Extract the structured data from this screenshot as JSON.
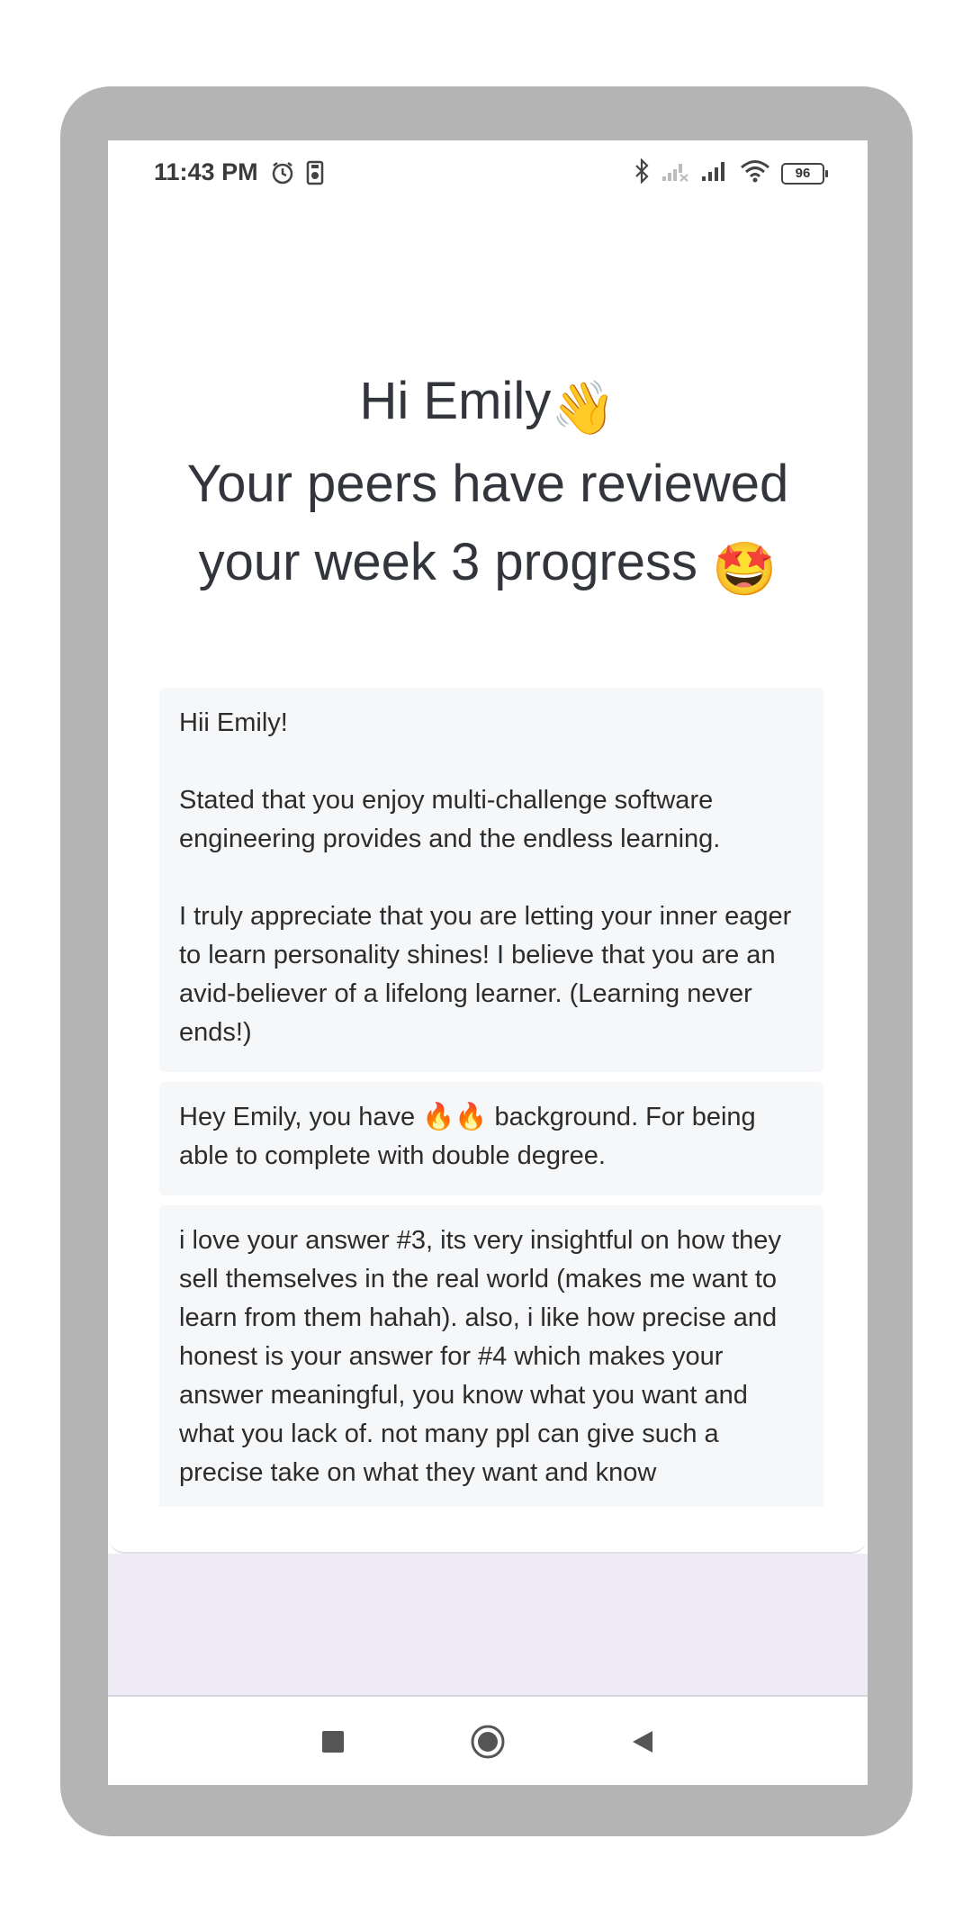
{
  "status_bar": {
    "time": "11:43 PM",
    "left_icons": [
      "alarm-icon",
      "storage-icon"
    ],
    "right_icons": [
      "bluetooth-icon",
      "signal-nosim-icon",
      "signal-icon",
      "wifi-icon"
    ],
    "battery": "96"
  },
  "greeting": {
    "line1": "Hi Emily",
    "line1_emoji": "👋",
    "line2": "Your peers have reviewed",
    "line3": "your week 3 progress",
    "line3_emoji": "🤩"
  },
  "reviews": [
    {
      "text": "Hii Emily!\n\nStated that you enjoy multi-challenge software engineering provides and the endless learning.\n\nI truly appreciate that you are letting your inner eager to learn personality shines! I believe that you are an avid-believer of a lifelong learner. (Learning never ends!)"
    },
    {
      "text": "Hey Emily, you have 🔥🔥 background. For being able to complete with double degree."
    },
    {
      "text": "i love your answer #3, its very insightful on how they sell themselves in the real world (makes me want to learn from them hahah). also, i like how precise and honest is your answer for #4 which makes your answer meaningful, you know what you want and what you lack of. not many ppl can give such a precise take on what they want and know"
    }
  ],
  "nav": [
    "recents-button",
    "home-button",
    "back-button"
  ],
  "colors": {
    "device_frame": "#b4b4b4",
    "card_bg": "#f6f7f9",
    "bottom_bg": "#eeebf6",
    "text": "#33353d"
  }
}
